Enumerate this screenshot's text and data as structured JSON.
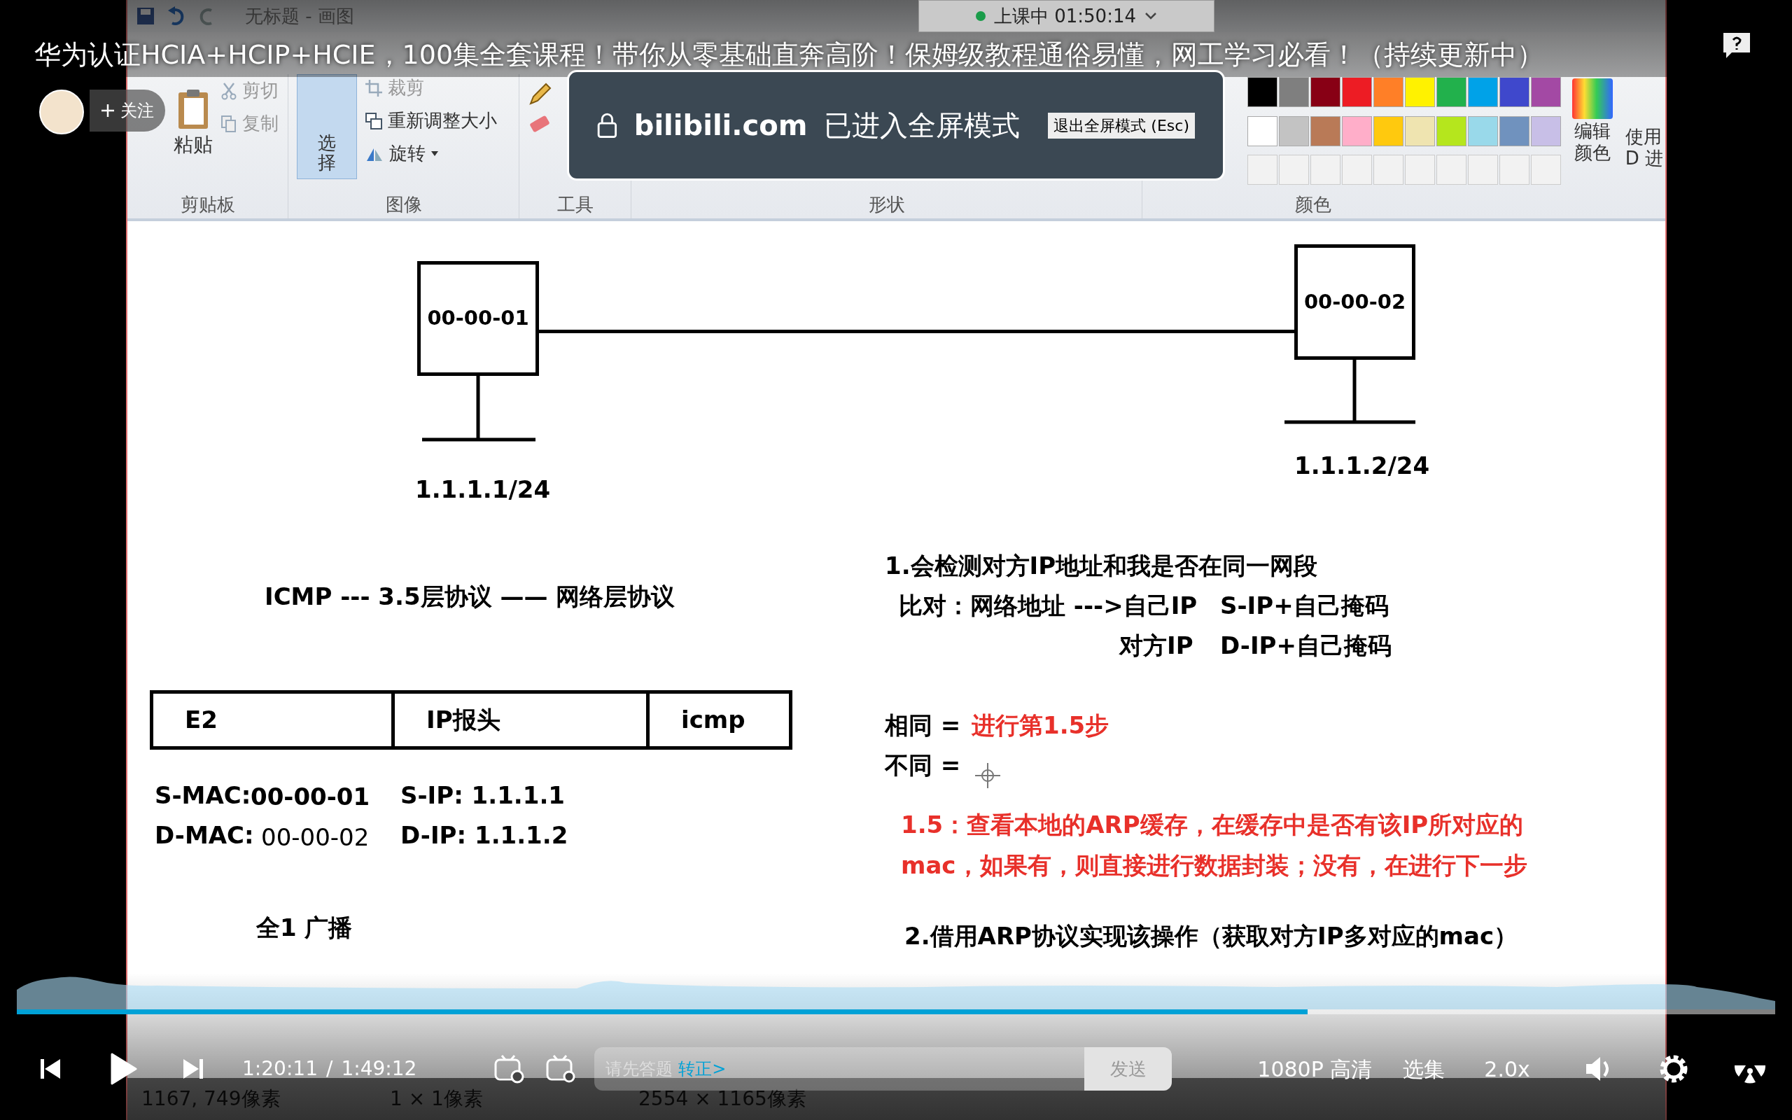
{
  "video": {
    "title": "华为认证HCIA+HCIP+HCIE，100集全套课程！带你从零基础直奔高阶！保姆级教程通俗易懂，网工学习必看！（持续更新中）",
    "follow": "关注"
  },
  "live_badge": {
    "text": "上课中 01:50:14"
  },
  "fullscreen_notice": {
    "site": "bilibili.com",
    "message": "已进入全屏模式",
    "exit_hint": "退出全屏模式 (Esc)"
  },
  "paint": {
    "title": "无标题 - 画图",
    "clipboard": {
      "paste": "粘贴",
      "cut": "剪切",
      "copy": "复制",
      "label": "剪贴板"
    },
    "image": {
      "select": "选择",
      "crop": "裁剪",
      "resize": "重新调整大小",
      "rotate": "旋转",
      "label": "图像"
    },
    "tools": {
      "label": "工具"
    },
    "shapes": {
      "label": "形状"
    },
    "colors": {
      "label": "颜色",
      "edit": "编辑颜色",
      "use_3d": "使用 D 进",
      "palette": [
        {
          "color": "#000000"
        },
        {
          "color": "#7f7f7f"
        },
        {
          "color": "#880015"
        },
        {
          "color": "#ed1c24"
        },
        {
          "color": "#ff7f27"
        },
        {
          "color": "#fff200"
        },
        {
          "color": "#22b14c"
        },
        {
          "color": "#00a2e8"
        },
        {
          "color": "#3f48cc"
        },
        {
          "color": "#a349a4"
        },
        {
          "color": "#ffffff"
        },
        {
          "color": "#c3c3c3"
        },
        {
          "color": "#b97a57"
        },
        {
          "color": "#ffaec9"
        },
        {
          "color": "#ffc90e"
        },
        {
          "color": "#efe4b0"
        },
        {
          "color": "#b5e61d"
        },
        {
          "color": "#99d9ea"
        },
        {
          "color": "#7092be"
        },
        {
          "color": "#c8bfe7"
        }
      ]
    },
    "canvas": {
      "hosts": [
        {
          "mac": "00-00-01",
          "ip": "1.1.1.1/24"
        },
        {
          "mac": "00-00-02",
          "ip": "1.1.1.2/24"
        }
      ],
      "frame": [
        {
          "label": "E2"
        },
        {
          "label": "IP报头"
        },
        {
          "label": "icmp"
        }
      ],
      "notes": [
        {
          "text": "ICMP --- 3.5层协议   —— 网络层协议",
          "color": "#000000"
        },
        {
          "text": "S-MAC:",
          "color": "#000000"
        },
        {
          "text": "00-00-01",
          "color": "#000000"
        },
        {
          "text": "D-MAC:",
          "color": "#000000"
        },
        {
          "text": "00-00-02",
          "color": "#000000"
        },
        {
          "text": "S-IP: 1.1.1.1",
          "color": "#000000"
        },
        {
          "text": "D-IP: 1.1.1.2",
          "color": "#000000"
        },
        {
          "text": "全1  广播",
          "color": "#000000"
        },
        {
          "text": "1.会检测对方IP地址和我是否在同一网段",
          "color": "#000000"
        },
        {
          "text": "比对：网络地址 --->自己IP",
          "color": "#000000"
        },
        {
          "text": "S-IP+自己掩码",
          "color": "#000000"
        },
        {
          "text": "对方IP",
          "color": "#000000"
        },
        {
          "text": "D-IP+自己掩码",
          "color": "#000000"
        },
        {
          "text": "相同 =",
          "color": "#000000"
        },
        {
          "text": "进行第1.5步",
          "color": "#e8302a"
        },
        {
          "text": "不同 =",
          "color": "#000000"
        },
        {
          "text": "1.5：查看本地的ARP缓存，在缓存中是否有该IP所对应的",
          "color": "#e8302a"
        },
        {
          "text": "mac，如果有，则直接进行数据封装；没有，在进行下一步",
          "color": "#e8302a"
        },
        {
          "text": "2.借用ARP协议实现该操作（获取对方IP多对应的mac）",
          "color": "#000000"
        }
      ]
    },
    "status_bar": [
      "1167, 749像素",
      "1 × 1像素",
      "2554 × 1165像素"
    ]
  },
  "player": {
    "progress": {
      "level": 0.734
    },
    "time_current": "1:20:11",
    "time_separator": "/",
    "time_total": "1:49:12",
    "danmaku_placeholder": "请先答题",
    "danmaku_link": "转正>",
    "send": "发送",
    "quality": "1080P 高清",
    "episodes": "选集",
    "speed": "2.0x"
  }
}
